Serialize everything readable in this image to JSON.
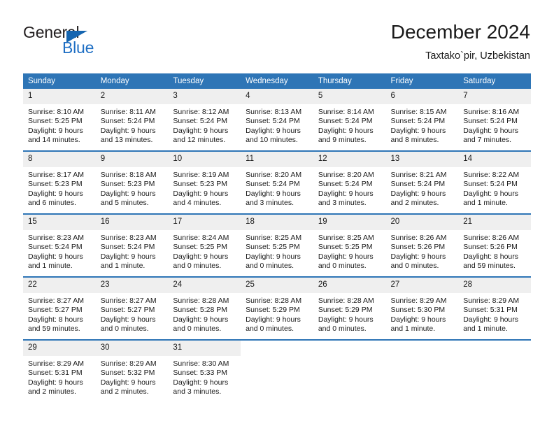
{
  "brand": {
    "line1": "General",
    "line2": "Blue",
    "triangle_color": "#1565b0",
    "blue_color": "#1f6fc4"
  },
  "header": {
    "title": "December 2024",
    "location": "Taxtako`pir, Uzbekistan"
  },
  "calendar": {
    "header_bg": "#2e75b6",
    "daynum_bg": "#efefef",
    "weekdays": [
      "Sunday",
      "Monday",
      "Tuesday",
      "Wednesday",
      "Thursday",
      "Friday",
      "Saturday"
    ],
    "weeks": [
      [
        {
          "day": "1",
          "sunrise": "Sunrise: 8:10 AM",
          "sunset": "Sunset: 5:25 PM",
          "daylight1": "Daylight: 9 hours",
          "daylight2": "and 14 minutes."
        },
        {
          "day": "2",
          "sunrise": "Sunrise: 8:11 AM",
          "sunset": "Sunset: 5:24 PM",
          "daylight1": "Daylight: 9 hours",
          "daylight2": "and 13 minutes."
        },
        {
          "day": "3",
          "sunrise": "Sunrise: 8:12 AM",
          "sunset": "Sunset: 5:24 PM",
          "daylight1": "Daylight: 9 hours",
          "daylight2": "and 12 minutes."
        },
        {
          "day": "4",
          "sunrise": "Sunrise: 8:13 AM",
          "sunset": "Sunset: 5:24 PM",
          "daylight1": "Daylight: 9 hours",
          "daylight2": "and 10 minutes."
        },
        {
          "day": "5",
          "sunrise": "Sunrise: 8:14 AM",
          "sunset": "Sunset: 5:24 PM",
          "daylight1": "Daylight: 9 hours",
          "daylight2": "and 9 minutes."
        },
        {
          "day": "6",
          "sunrise": "Sunrise: 8:15 AM",
          "sunset": "Sunset: 5:24 PM",
          "daylight1": "Daylight: 9 hours",
          "daylight2": "and 8 minutes."
        },
        {
          "day": "7",
          "sunrise": "Sunrise: 8:16 AM",
          "sunset": "Sunset: 5:24 PM",
          "daylight1": "Daylight: 9 hours",
          "daylight2": "and 7 minutes."
        }
      ],
      [
        {
          "day": "8",
          "sunrise": "Sunrise: 8:17 AM",
          "sunset": "Sunset: 5:23 PM",
          "daylight1": "Daylight: 9 hours",
          "daylight2": "and 6 minutes."
        },
        {
          "day": "9",
          "sunrise": "Sunrise: 8:18 AM",
          "sunset": "Sunset: 5:23 PM",
          "daylight1": "Daylight: 9 hours",
          "daylight2": "and 5 minutes."
        },
        {
          "day": "10",
          "sunrise": "Sunrise: 8:19 AM",
          "sunset": "Sunset: 5:23 PM",
          "daylight1": "Daylight: 9 hours",
          "daylight2": "and 4 minutes."
        },
        {
          "day": "11",
          "sunrise": "Sunrise: 8:20 AM",
          "sunset": "Sunset: 5:24 PM",
          "daylight1": "Daylight: 9 hours",
          "daylight2": "and 3 minutes."
        },
        {
          "day": "12",
          "sunrise": "Sunrise: 8:20 AM",
          "sunset": "Sunset: 5:24 PM",
          "daylight1": "Daylight: 9 hours",
          "daylight2": "and 3 minutes."
        },
        {
          "day": "13",
          "sunrise": "Sunrise: 8:21 AM",
          "sunset": "Sunset: 5:24 PM",
          "daylight1": "Daylight: 9 hours",
          "daylight2": "and 2 minutes."
        },
        {
          "day": "14",
          "sunrise": "Sunrise: 8:22 AM",
          "sunset": "Sunset: 5:24 PM",
          "daylight1": "Daylight: 9 hours",
          "daylight2": "and 1 minute."
        }
      ],
      [
        {
          "day": "15",
          "sunrise": "Sunrise: 8:23 AM",
          "sunset": "Sunset: 5:24 PM",
          "daylight1": "Daylight: 9 hours",
          "daylight2": "and 1 minute."
        },
        {
          "day": "16",
          "sunrise": "Sunrise: 8:23 AM",
          "sunset": "Sunset: 5:24 PM",
          "daylight1": "Daylight: 9 hours",
          "daylight2": "and 1 minute."
        },
        {
          "day": "17",
          "sunrise": "Sunrise: 8:24 AM",
          "sunset": "Sunset: 5:25 PM",
          "daylight1": "Daylight: 9 hours",
          "daylight2": "and 0 minutes."
        },
        {
          "day": "18",
          "sunrise": "Sunrise: 8:25 AM",
          "sunset": "Sunset: 5:25 PM",
          "daylight1": "Daylight: 9 hours",
          "daylight2": "and 0 minutes."
        },
        {
          "day": "19",
          "sunrise": "Sunrise: 8:25 AM",
          "sunset": "Sunset: 5:25 PM",
          "daylight1": "Daylight: 9 hours",
          "daylight2": "and 0 minutes."
        },
        {
          "day": "20",
          "sunrise": "Sunrise: 8:26 AM",
          "sunset": "Sunset: 5:26 PM",
          "daylight1": "Daylight: 9 hours",
          "daylight2": "and 0 minutes."
        },
        {
          "day": "21",
          "sunrise": "Sunrise: 8:26 AM",
          "sunset": "Sunset: 5:26 PM",
          "daylight1": "Daylight: 8 hours",
          "daylight2": "and 59 minutes."
        }
      ],
      [
        {
          "day": "22",
          "sunrise": "Sunrise: 8:27 AM",
          "sunset": "Sunset: 5:27 PM",
          "daylight1": "Daylight: 8 hours",
          "daylight2": "and 59 minutes."
        },
        {
          "day": "23",
          "sunrise": "Sunrise: 8:27 AM",
          "sunset": "Sunset: 5:27 PM",
          "daylight1": "Daylight: 9 hours",
          "daylight2": "and 0 minutes."
        },
        {
          "day": "24",
          "sunrise": "Sunrise: 8:28 AM",
          "sunset": "Sunset: 5:28 PM",
          "daylight1": "Daylight: 9 hours",
          "daylight2": "and 0 minutes."
        },
        {
          "day": "25",
          "sunrise": "Sunrise: 8:28 AM",
          "sunset": "Sunset: 5:29 PM",
          "daylight1": "Daylight: 9 hours",
          "daylight2": "and 0 minutes."
        },
        {
          "day": "26",
          "sunrise": "Sunrise: 8:28 AM",
          "sunset": "Sunset: 5:29 PM",
          "daylight1": "Daylight: 9 hours",
          "daylight2": "and 0 minutes."
        },
        {
          "day": "27",
          "sunrise": "Sunrise: 8:29 AM",
          "sunset": "Sunset: 5:30 PM",
          "daylight1": "Daylight: 9 hours",
          "daylight2": "and 1 minute."
        },
        {
          "day": "28",
          "sunrise": "Sunrise: 8:29 AM",
          "sunset": "Sunset: 5:31 PM",
          "daylight1": "Daylight: 9 hours",
          "daylight2": "and 1 minute."
        }
      ],
      [
        {
          "day": "29",
          "sunrise": "Sunrise: 8:29 AM",
          "sunset": "Sunset: 5:31 PM",
          "daylight1": "Daylight: 9 hours",
          "daylight2": "and 2 minutes."
        },
        {
          "day": "30",
          "sunrise": "Sunrise: 8:29 AM",
          "sunset": "Sunset: 5:32 PM",
          "daylight1": "Daylight: 9 hours",
          "daylight2": "and 2 minutes."
        },
        {
          "day": "31",
          "sunrise": "Sunrise: 8:30 AM",
          "sunset": "Sunset: 5:33 PM",
          "daylight1": "Daylight: 9 hours",
          "daylight2": "and 3 minutes."
        },
        {
          "day": "",
          "sunrise": "",
          "sunset": "",
          "daylight1": "",
          "daylight2": ""
        },
        {
          "day": "",
          "sunrise": "",
          "sunset": "",
          "daylight1": "",
          "daylight2": ""
        },
        {
          "day": "",
          "sunrise": "",
          "sunset": "",
          "daylight1": "",
          "daylight2": ""
        },
        {
          "day": "",
          "sunrise": "",
          "sunset": "",
          "daylight1": "",
          "daylight2": ""
        }
      ]
    ]
  }
}
